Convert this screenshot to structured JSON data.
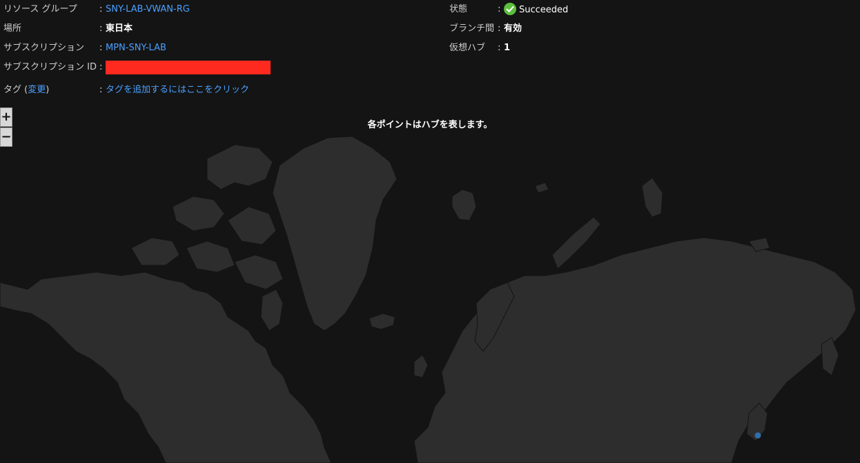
{
  "properties": {
    "resource_group": {
      "label": "リソース グループ",
      "value": "SNY-LAB-VWAN-RG"
    },
    "location": {
      "label": "場所",
      "value": "東日本"
    },
    "subscription": {
      "label": "サブスクリプション",
      "value": "MPN-SNY-LAB"
    },
    "subscription_id": {
      "label": "サブスクリプション ID"
    },
    "tags": {
      "label_prefix": "タグ (",
      "change_link": "変更",
      "label_suffix": ")",
      "value": "タグを追加するにはここをクリック"
    },
    "status": {
      "label": "状態",
      "value": "Succeeded"
    },
    "branch": {
      "label": "ブランチ間",
      "value": "有効"
    },
    "hubs": {
      "label": "仮想ハブ",
      "value": "1"
    },
    "separator": ":"
  },
  "map": {
    "caption": "各ポイントはハブを表します。",
    "zoom_in": "+",
    "zoom_out": "−",
    "hub_color": "#2f6fa8",
    "land_color": "#2d2d2d"
  }
}
